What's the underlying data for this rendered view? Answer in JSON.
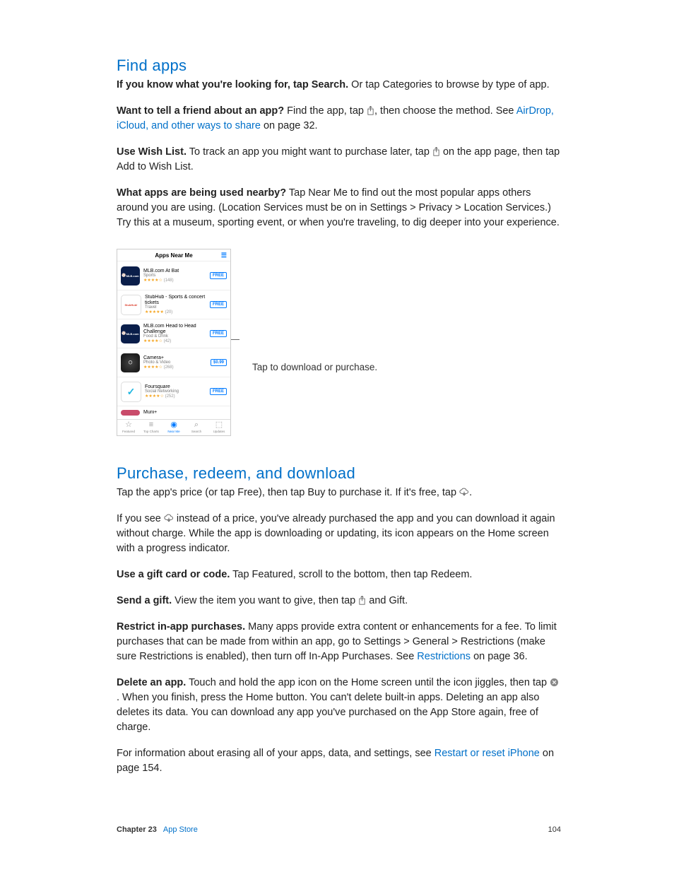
{
  "section1": {
    "title": "Find apps",
    "p1": {
      "bold": "If you know what you're looking for, tap Search.",
      "text": " Or tap Categories to browse by type of app."
    },
    "p2": {
      "bold": "Want to tell a friend about an app?",
      "t1": " Find the app, tap ",
      "t2": ", then choose the method. See ",
      "link": "AirDrop, iCloud, and other ways to share",
      "t3": " on page 32."
    },
    "p3": {
      "bold": "Use Wish List.",
      "t1": " To track an app you might want to purchase later, tap ",
      "t2": " on the app page, then tap Add to Wish List."
    },
    "p4": {
      "bold": "What apps are being used nearby?",
      "text": "  Tap Near Me to find out the most popular apps others around you are using. (Location Services must be on in Settings > Privacy > Location Services.) Try this at a museum, sporting event, or when you're traveling, to dig deeper into your experience."
    }
  },
  "screenshot": {
    "header": "Apps Near Me",
    "apps": [
      {
        "name": "MLB.com At Bat",
        "category": "Sports",
        "rating": "★★★★☆",
        "count": "(148)",
        "price": "FREE",
        "iconBg": "#0a1e4a",
        "iconText": "MLB.com"
      },
      {
        "name": "StubHub - Sports & concert tickets",
        "category": "Travel",
        "rating": "★★★★★",
        "count": "(20)",
        "price": "FREE",
        "iconBg": "#3a6fd8",
        "iconText": "StubHub!"
      },
      {
        "name": "MLB.com Head to Head Challenge",
        "category": "Food & Drink",
        "rating": "★★★★☆",
        "count": "(42)",
        "price": "FREE",
        "iconBg": "#0a1e4a",
        "iconText": "MLB.com"
      },
      {
        "name": "Camera+",
        "category": "Photo & Video",
        "rating": "★★★★☆",
        "count": "(268)",
        "price": "$0.99",
        "iconBg": "#222",
        "iconText": ""
      },
      {
        "name": "Foursquare",
        "category": "Social Networking",
        "rating": "★★★★☆",
        "count": "(252)",
        "price": "FREE",
        "iconBg": "#1fb6e0",
        "iconText": ""
      },
      {
        "name": "Muni+",
        "category": "",
        "rating": "",
        "count": "",
        "price": "",
        "iconBg": "#c94b6a",
        "iconText": ""
      }
    ],
    "tabs": [
      {
        "icon": "☆",
        "label": "Featured"
      },
      {
        "icon": "≡",
        "label": "Top Charts"
      },
      {
        "icon": "◉",
        "label": "Near Me"
      },
      {
        "icon": "⌕",
        "label": "Search"
      },
      {
        "icon": "⬚",
        "label": "Updates"
      }
    ],
    "callout": "Tap to download or purchase."
  },
  "section2": {
    "title": "Purchase, redeem, and download",
    "p1": {
      "t1": "Tap the app's price (or tap Free), then tap Buy to purchase it. If it's free, tap ",
      "t2": "."
    },
    "p2": {
      "t1": "If you see ",
      "t2": " instead of a price, you've already purchased the app and you can download it again without charge. While the app is downloading or updating, its icon appears on the Home screen with a progress indicator."
    },
    "p3": {
      "bold": "Use a gift card or code.",
      "text": " Tap Featured, scroll to the bottom, then tap Redeem."
    },
    "p4": {
      "bold": "Send a gift.",
      "t1": " View the item you want to give, then tap ",
      "t2": " and Gift."
    },
    "p5": {
      "bold": "Restrict in-app purchases.",
      "t1": " Many apps provide extra content or enhancements for a fee. To limit purchases that can be made from within an app, go to Settings > General > Restrictions (make sure Restrictions is enabled), then turn off In-App Purchases. See ",
      "link": "Restrictions",
      "t2": " on page 36."
    },
    "p6": {
      "bold": "Delete an app.",
      "t1": " Touch and hold the app icon on the Home screen until the icon jiggles, then tap ",
      "t2": ". When you finish, press the Home button. You can't delete built-in apps. Deleting an app also deletes its data. You can download any app you've purchased on the App Store again, free of charge."
    },
    "p7": {
      "t1": "For information about erasing all of your apps, data, and settings, see ",
      "link": "Restart or reset iPhone",
      "t2": " on page 154."
    }
  },
  "footer": {
    "chapter": "Chapter  23",
    "title": "App Store",
    "page": "104"
  }
}
